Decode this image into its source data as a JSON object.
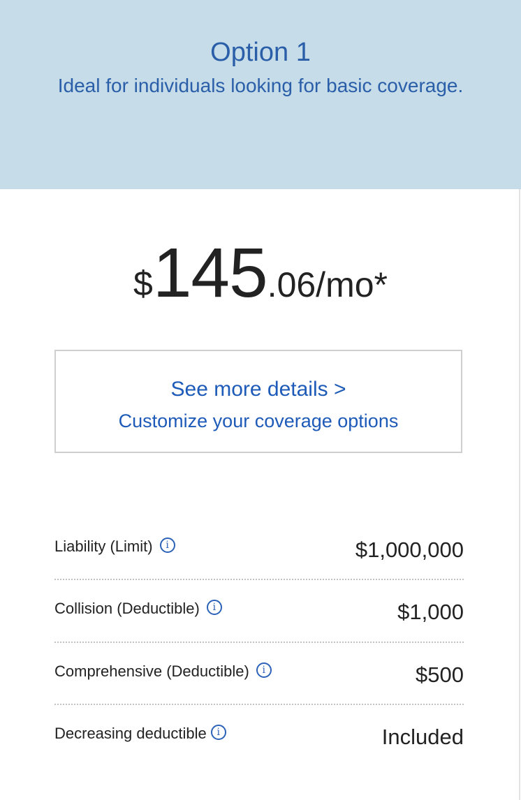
{
  "header": {
    "title": "Option 1",
    "subtitle": "Ideal for individuals looking for basic coverage."
  },
  "price": {
    "currency": "$",
    "whole": "145",
    "fraction": ".06/mo*"
  },
  "details": {
    "link_label": "See more details >",
    "sub_label": "Customize your coverage options"
  },
  "coverages": [
    {
      "label": "Liability (Limit)",
      "value": "$1,000,000",
      "icon": "info-icon"
    },
    {
      "label": "Collision (Deductible)",
      "value": "$1,000",
      "icon": "info-icon"
    },
    {
      "label": "Comprehensive (Deductible)",
      "value": "$500",
      "icon": "info-icon"
    },
    {
      "label": "Decreasing deductible",
      "value": "Included",
      "icon": "info-icon"
    }
  ],
  "colors": {
    "header_bg": "#c6dde9",
    "accent_blue": "#1e5bb8"
  }
}
